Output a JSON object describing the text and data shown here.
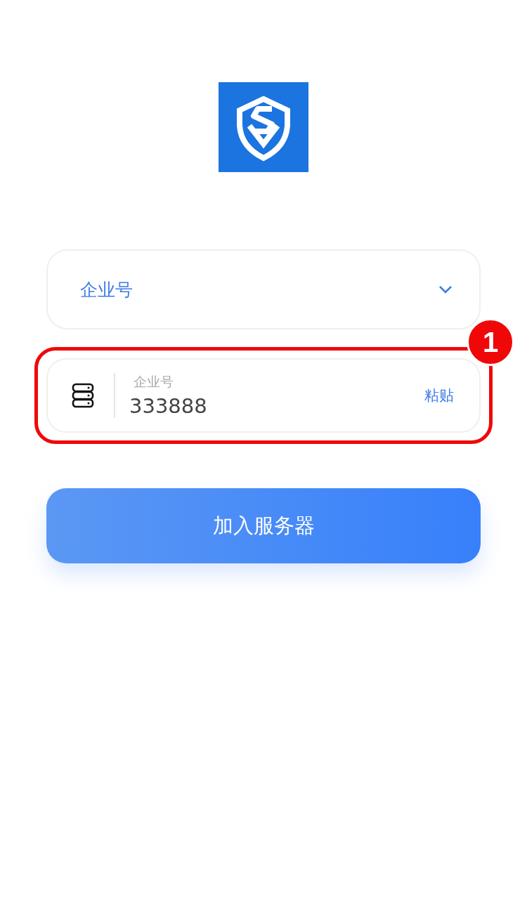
{
  "type_select": {
    "value": "企业号"
  },
  "company_field": {
    "label": "企业号",
    "value": "333888",
    "paste": "粘贴"
  },
  "annotation": {
    "badge": "1"
  },
  "join_button": {
    "label": "加入服务器"
  }
}
